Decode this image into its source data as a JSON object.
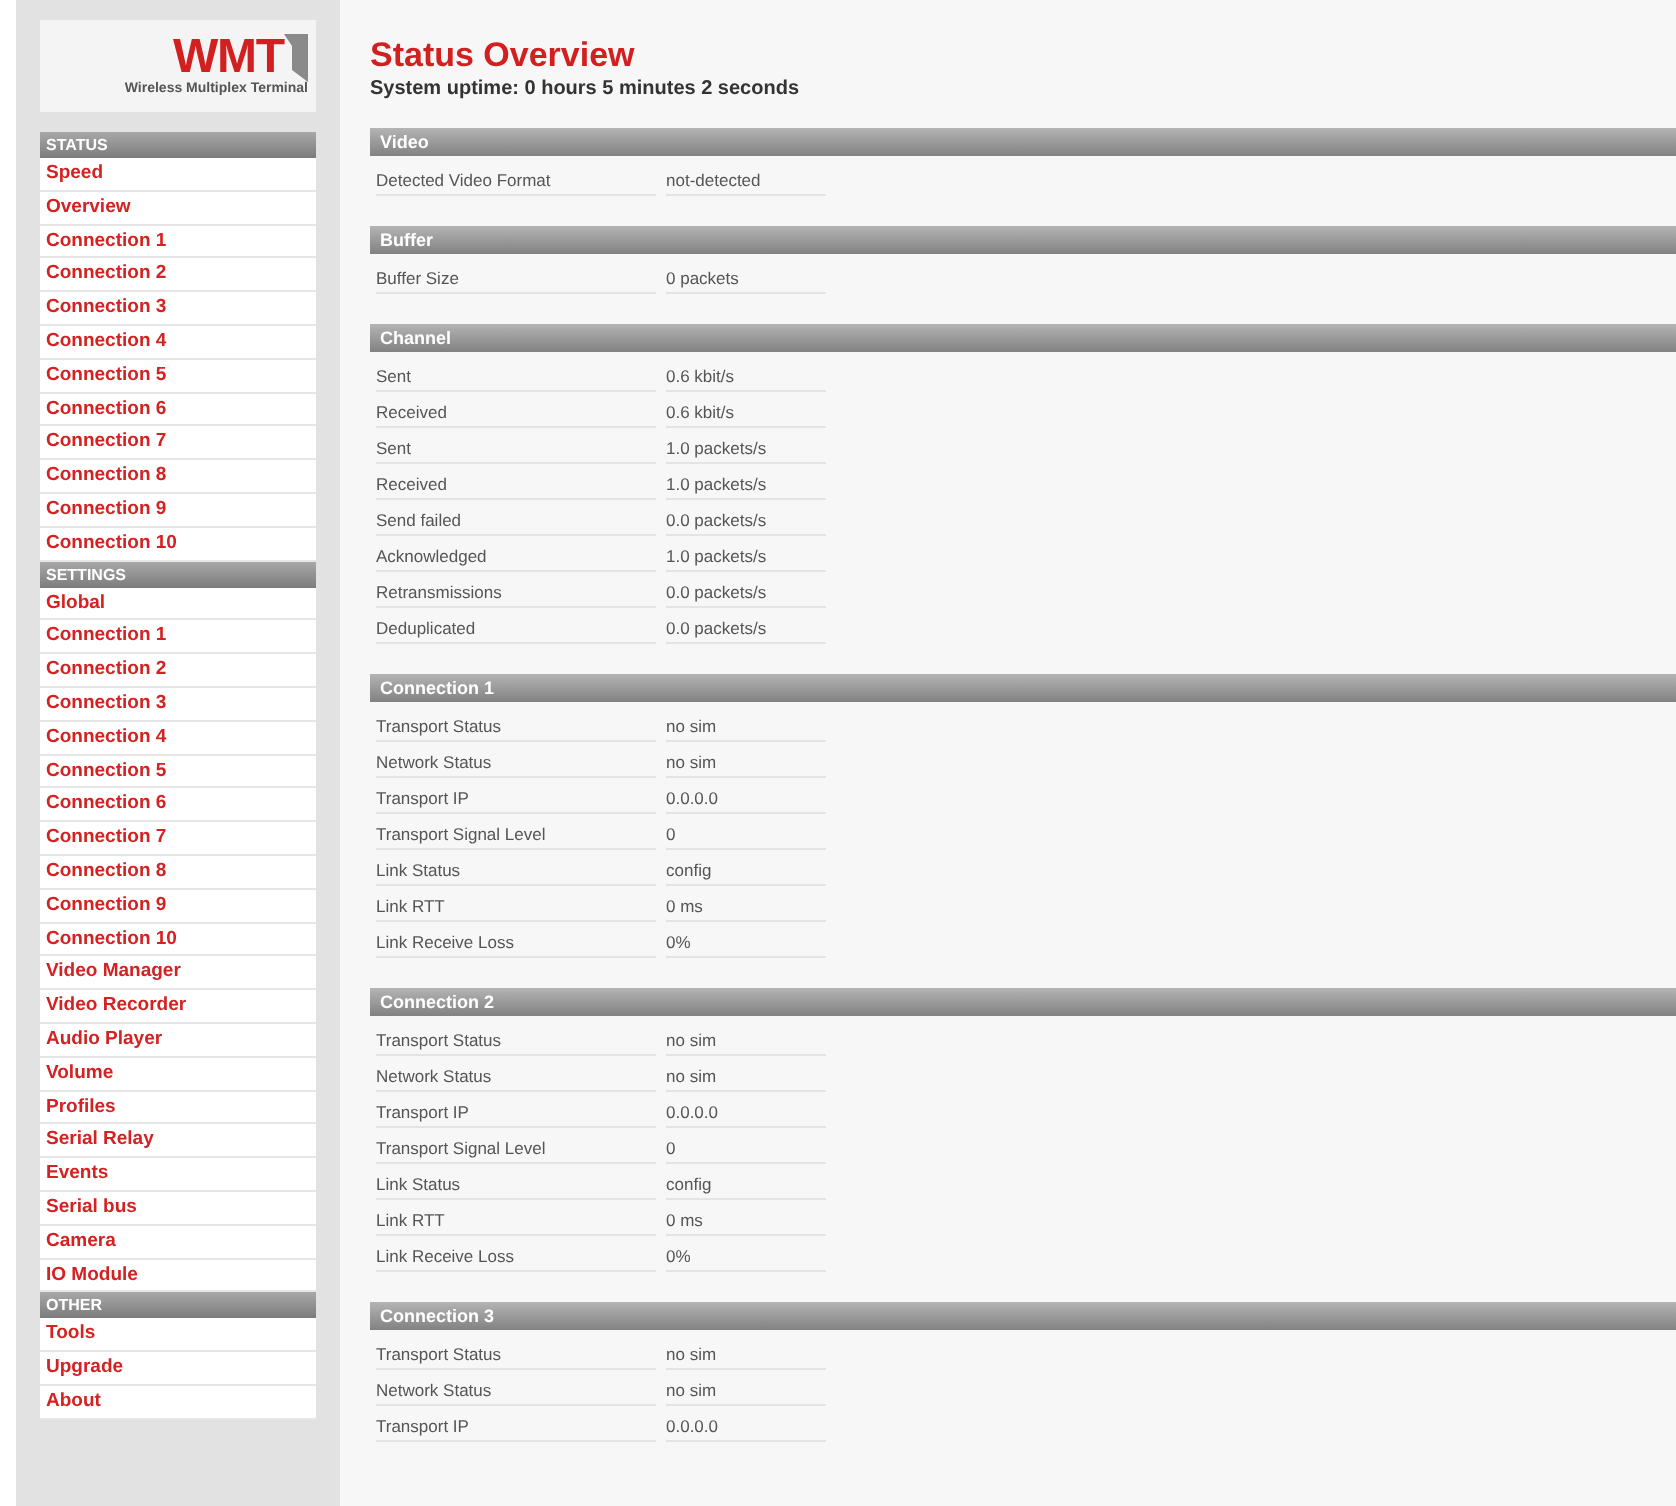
{
  "logo": {
    "mark": "WMT",
    "subtitle": "Wireless Multiplex Terminal"
  },
  "sidebar": [
    {
      "title": "STATUS",
      "items": [
        "Speed",
        "Overview",
        "Connection 1",
        "Connection 2",
        "Connection 3",
        "Connection 4",
        "Connection 5",
        "Connection 6",
        "Connection 7",
        "Connection 8",
        "Connection 9",
        "Connection 10"
      ]
    },
    {
      "title": "SETTINGS",
      "items": [
        "Global",
        "Connection 1",
        "Connection 2",
        "Connection 3",
        "Connection 4",
        "Connection 5",
        "Connection 6",
        "Connection 7",
        "Connection 8",
        "Connection 9",
        "Connection 10",
        "Video Manager",
        "Video Recorder",
        "Audio Player",
        "Volume",
        "Profiles",
        "Serial Relay",
        "Events",
        "Serial bus",
        "Camera",
        "IO Module"
      ]
    },
    {
      "title": "OTHER",
      "items": [
        "Tools",
        "Upgrade",
        "About"
      ]
    }
  ],
  "main": {
    "title": "Status Overview",
    "uptime": "System uptime: 0 hours 5 minutes 2 seconds",
    "sections": [
      {
        "title": "Video",
        "rows": [
          {
            "label": "Detected Video Format",
            "value": "not-detected"
          }
        ]
      },
      {
        "title": "Buffer",
        "rows": [
          {
            "label": "Buffer Size",
            "value": "0 packets"
          }
        ]
      },
      {
        "title": "Channel",
        "rows": [
          {
            "label": "Sent",
            "value": "0.6 kbit/s"
          },
          {
            "label": "Received",
            "value": "0.6 kbit/s"
          },
          {
            "label": "Sent",
            "value": "1.0 packets/s"
          },
          {
            "label": "Received",
            "value": "1.0 packets/s"
          },
          {
            "label": "Send failed",
            "value": "0.0 packets/s"
          },
          {
            "label": "Acknowledged",
            "value": "1.0 packets/s"
          },
          {
            "label": "Retransmissions",
            "value": "0.0 packets/s"
          },
          {
            "label": "Deduplicated",
            "value": "0.0 packets/s"
          }
        ]
      },
      {
        "title": "Connection 1",
        "rows": [
          {
            "label": "Transport Status",
            "value": "no sim"
          },
          {
            "label": "Network Status",
            "value": "no sim"
          },
          {
            "label": "Transport IP",
            "value": "0.0.0.0"
          },
          {
            "label": "Transport Signal Level",
            "value": "0"
          },
          {
            "label": "Link Status",
            "value": "config"
          },
          {
            "label": "Link RTT",
            "value": "0 ms"
          },
          {
            "label": "Link Receive Loss",
            "value": "0%"
          }
        ]
      },
      {
        "title": "Connection 2",
        "rows": [
          {
            "label": "Transport Status",
            "value": "no sim"
          },
          {
            "label": "Network Status",
            "value": "no sim"
          },
          {
            "label": "Transport IP",
            "value": "0.0.0.0"
          },
          {
            "label": "Transport Signal Level",
            "value": "0"
          },
          {
            "label": "Link Status",
            "value": "config"
          },
          {
            "label": "Link RTT",
            "value": "0 ms"
          },
          {
            "label": "Link Receive Loss",
            "value": "0%"
          }
        ]
      },
      {
        "title": "Connection 3",
        "rows": [
          {
            "label": "Transport Status",
            "value": "no sim"
          },
          {
            "label": "Network Status",
            "value": "no sim"
          },
          {
            "label": "Transport IP",
            "value": "0.0.0.0"
          }
        ]
      }
    ]
  }
}
